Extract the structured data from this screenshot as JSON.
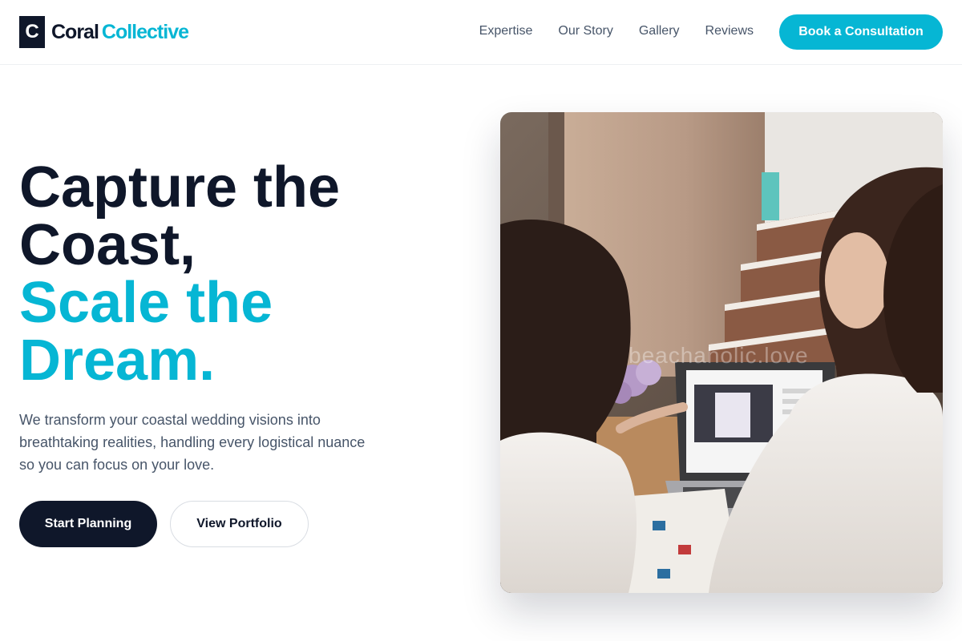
{
  "brand": {
    "mark": "C",
    "name_primary": "Coral",
    "name_accent": "Collective"
  },
  "nav": {
    "items": [
      {
        "label": "Expertise"
      },
      {
        "label": "Our Story"
      },
      {
        "label": "Gallery"
      },
      {
        "label": "Reviews"
      }
    ],
    "cta_label": "Book a Consultation"
  },
  "hero": {
    "title_line1": "Capture the",
    "title_line2": "Coast,",
    "title_line3": "Scale the",
    "title_line4": "Dream.",
    "description": "We transform your coastal wedding visions into breathtaking realities, handling every logistical nuance so you can focus on your love.",
    "primary_button": "Start Planning",
    "secondary_button": "View Portfolio",
    "image_watermark": "beachaholic.love"
  },
  "colors": {
    "accent": "#06b6d4",
    "dark": "#0f172a",
    "muted_text": "#475569"
  },
  "icons": {
    "logo": "letter-c-logo-icon"
  }
}
